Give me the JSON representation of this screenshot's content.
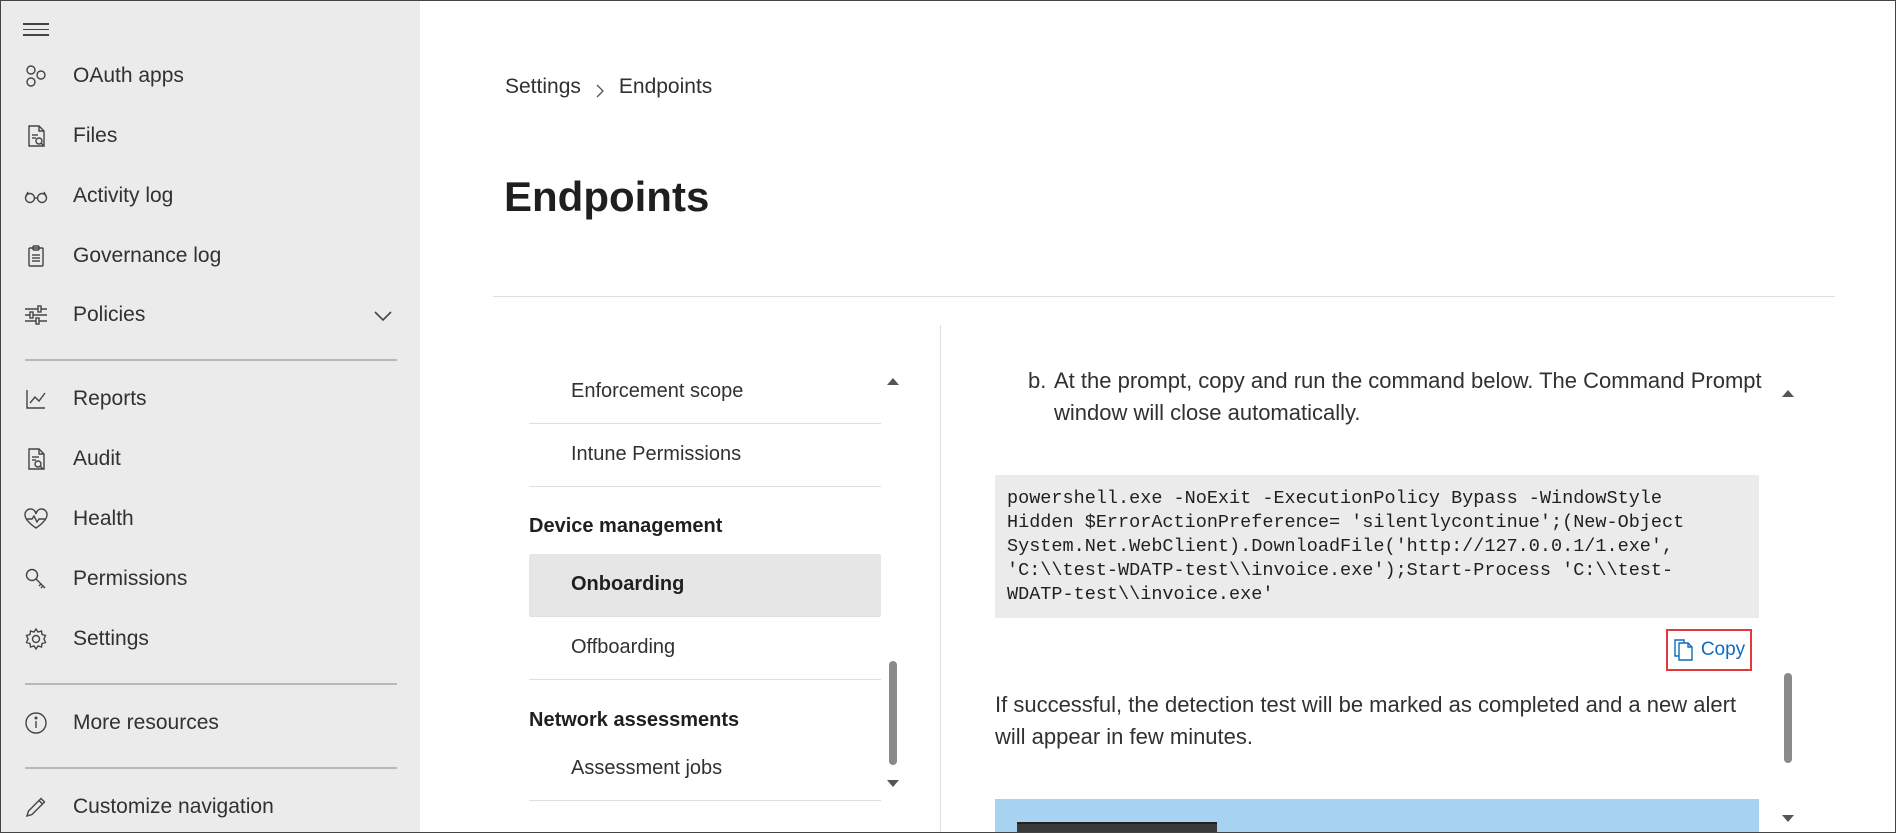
{
  "sidebar": {
    "items": [
      {
        "label": "OAuth apps",
        "icon": "oauth-apps-icon"
      },
      {
        "label": "Files",
        "icon": "files-icon"
      },
      {
        "label": "Activity log",
        "icon": "glasses-icon"
      },
      {
        "label": "Governance log",
        "icon": "clipboard-icon"
      },
      {
        "label": "Policies",
        "icon": "sliders-icon"
      },
      {
        "label": "Reports",
        "icon": "chart-icon"
      },
      {
        "label": "Audit",
        "icon": "audit-icon"
      },
      {
        "label": "Health",
        "icon": "heart-icon"
      },
      {
        "label": "Permissions",
        "icon": "key-icon"
      },
      {
        "label": "Settings",
        "icon": "gear-icon"
      },
      {
        "label": "More resources",
        "icon": "info-icon"
      },
      {
        "label": "Customize navigation",
        "icon": "pencil-icon"
      }
    ]
  },
  "breadcrumb": {
    "parent": "Settings",
    "current": "Endpoints"
  },
  "page": {
    "title": "Endpoints"
  },
  "settings_nav": {
    "items": [
      {
        "label": "Enforcement scope"
      },
      {
        "label": "Intune Permissions"
      },
      {
        "header": "Device management"
      },
      {
        "label": "Onboarding",
        "active": true
      },
      {
        "label": "Offboarding"
      },
      {
        "header": "Network assessments"
      },
      {
        "label": "Assessment jobs"
      }
    ]
  },
  "content": {
    "step_number": "b.",
    "step_text": "At the prompt, copy and run the command below. The Command Prompt window will close automatically.",
    "code": "powershell.exe -NoExit -ExecutionPolicy Bypass -WindowStyle\nHidden $ErrorActionPreference= 'silentlycontinue';(New-Object\nSystem.Net.WebClient).DownloadFile('http://127.0.0.1/1.exe',\n'C:\\\\test-WDATP-test\\\\invoice.exe');Start-Process 'C:\\\\test-\nWDATP-test\\\\invoice.exe'",
    "copy_label": "Copy",
    "result_text": "If successful, the detection test will be marked as completed and a new alert will appear in few minutes."
  },
  "colors": {
    "accent": "#0f6cbd",
    "highlight_border": "#e03a3a",
    "sidebar_bg": "#ebebeb"
  }
}
